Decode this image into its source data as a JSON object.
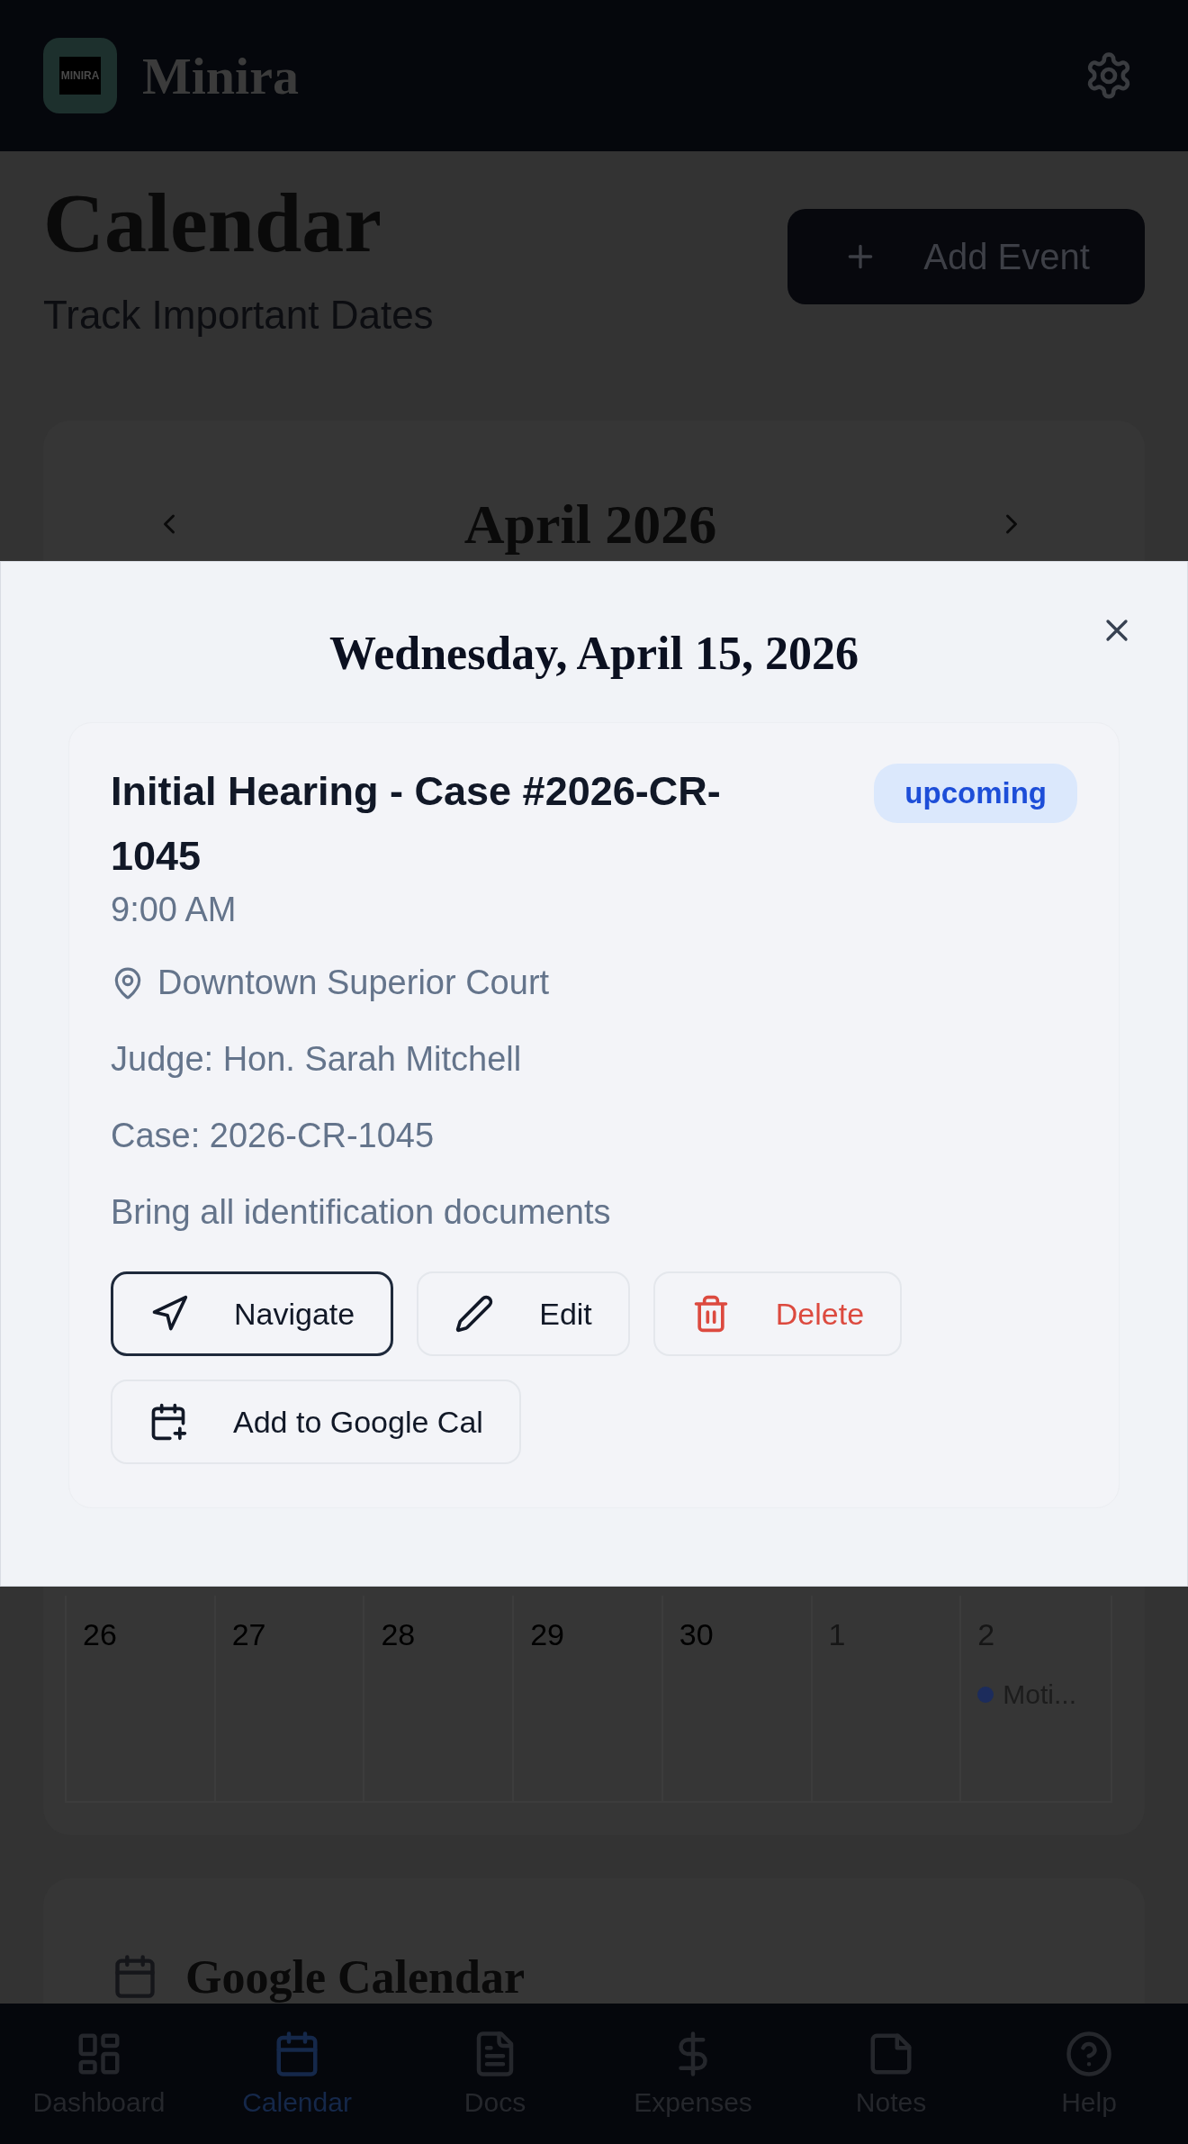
{
  "header": {
    "logo_text": "MINIRA",
    "app_name": "Minira"
  },
  "page": {
    "title": "Calendar",
    "subtitle": "Track Important Dates",
    "add_button": "Add Event"
  },
  "calendar": {
    "month": "April 2026",
    "visible_days": [
      {
        "day": "26",
        "outside": false
      },
      {
        "day": "27",
        "outside": false
      },
      {
        "day": "28",
        "outside": false
      },
      {
        "day": "29",
        "outside": false
      },
      {
        "day": "30",
        "outside": false
      },
      {
        "day": "1",
        "outside": true
      },
      {
        "day": "2",
        "outside": true,
        "events": [
          {
            "label": "Moti..."
          }
        ]
      }
    ]
  },
  "google_calendar": {
    "title": "Google Calendar"
  },
  "modal": {
    "title": "Wednesday, April 15, 2026",
    "event": {
      "title": "Initial Hearing - Case #2026-CR-1045",
      "status": "upcoming",
      "time": "9:00 AM",
      "location": "Downtown Superior Court",
      "details": [
        "Judge: Hon. Sarah Mitchell",
        "Case: 2026-CR-1045",
        "Bring all identification documents"
      ],
      "buttons": [
        {
          "label": "Navigate",
          "kind": "default",
          "focused": true
        },
        {
          "label": "Edit",
          "kind": "default",
          "focused": false
        },
        {
          "label": "Delete",
          "kind": "danger",
          "focused": false
        },
        {
          "label": "Add to Google Cal",
          "kind": "default",
          "focused": false
        }
      ]
    }
  },
  "bottom_nav": [
    {
      "label": "Dashboard",
      "selected": false
    },
    {
      "label": "Calendar",
      "selected": true
    },
    {
      "label": "Docs",
      "selected": false
    },
    {
      "label": "Expenses",
      "selected": false
    },
    {
      "label": "Notes",
      "selected": false
    },
    {
      "label": "Help",
      "selected": false
    }
  ]
}
